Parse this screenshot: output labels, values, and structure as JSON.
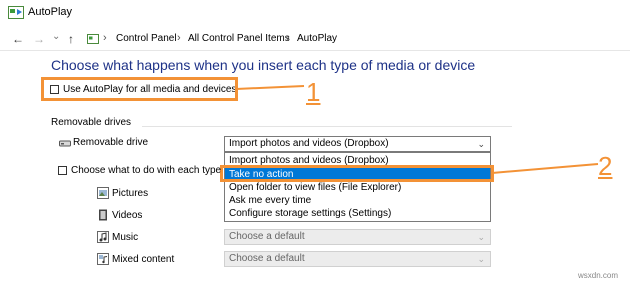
{
  "window": {
    "title": "AutoPlay"
  },
  "nav": {
    "back": "←",
    "forward": "→",
    "dropdown": "⌄",
    "up": "↑",
    "breadcrumbs": [
      "Control Panel",
      "All Control Panel Items",
      "AutoPlay"
    ],
    "separator": "›"
  },
  "heading": "Choose what happens when you insert each type of media or device",
  "use_autoplay": {
    "label": "Use AutoPlay for all media and devices",
    "checked": false
  },
  "removable": {
    "section_label": "Removable drives",
    "drive_label": "Removable drive",
    "selected": "Import photos and videos (Dropbox)",
    "options": [
      "Import photos and videos (Dropbox)",
      "Take no action",
      "Open folder to view files (File Explorer)",
      "Ask me every time",
      "Configure storage settings (Settings)"
    ],
    "highlighted_option": "Take no action"
  },
  "choose_each": {
    "label": "Choose what to do with each type of m",
    "checked": false
  },
  "media_types": [
    {
      "label": "Pictures",
      "value": ""
    },
    {
      "label": "Videos",
      "value": ""
    },
    {
      "label": "Music",
      "value": "Choose a default"
    },
    {
      "label": "Mixed content",
      "value": "Choose a default"
    }
  ],
  "callouts": {
    "one": "1",
    "two": "2"
  },
  "watermark": "wsxdn.com",
  "colors": {
    "accent": "#f39236",
    "selection": "#0078d7",
    "heading": "#1e3287"
  }
}
